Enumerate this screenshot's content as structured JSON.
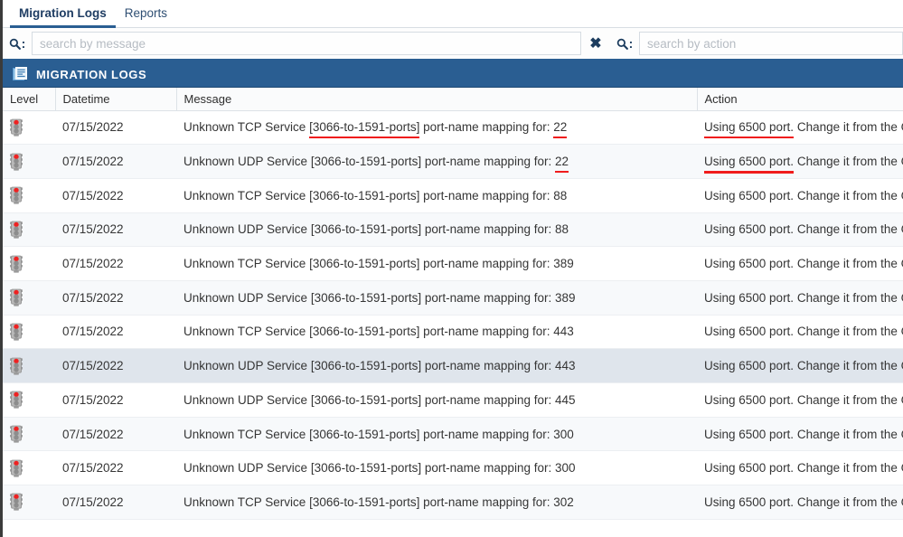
{
  "tabs": [
    {
      "label": "Migration Logs",
      "active": true
    },
    {
      "label": "Reports",
      "active": false
    }
  ],
  "search": {
    "message": {
      "placeholder": "search by message",
      "value": "",
      "icon": "search-icon",
      "colon": ":"
    },
    "action": {
      "placeholder": "search by action",
      "value": "",
      "icon": "search-icon",
      "colon": ":"
    },
    "clear_icon": "✖"
  },
  "panel": {
    "title": "MIGRATION LOGS",
    "icon": "document-report-icon",
    "header_color": "#2a5e92"
  },
  "table": {
    "columns": [
      "Level",
      "Datetime",
      "Message",
      "Action"
    ],
    "rows": [
      {
        "level_icon": "traffic-light-red-icon",
        "datetime": "07/15/2022",
        "message_pre": "Unknown TCP Service ",
        "message_mark": "[3066-to-1591-ports]",
        "message_mid": " port-name mapping for: ",
        "message_port": "22",
        "mark_underlined": true,
        "port_underlined": true,
        "action_mark": "Using 6500 port.",
        "action_rest": " Change it from the GUI",
        "action_underlined": true,
        "selected": false
      },
      {
        "level_icon": "traffic-light-red-icon",
        "datetime": "07/15/2022",
        "message_pre": "Unknown UDP Service ",
        "message_mark": "[3066-to-1591-ports]",
        "message_mid": " port-name mapping for: ",
        "message_port": "22",
        "mark_underlined": false,
        "port_underlined": true,
        "action_mark": "Using 6500 port.",
        "action_rest": " Change it from the GUI",
        "action_underlined": true,
        "selected": false
      },
      {
        "level_icon": "traffic-light-red-icon",
        "datetime": "07/15/2022",
        "message_pre": "Unknown TCP Service ",
        "message_mark": "[3066-to-1591-ports]",
        "message_mid": " port-name mapping for: ",
        "message_port": "88",
        "mark_underlined": false,
        "port_underlined": false,
        "action_mark": "Using 6500 port.",
        "action_rest": " Change it from the GUI",
        "action_underlined": false,
        "selected": false
      },
      {
        "level_icon": "traffic-light-red-icon",
        "datetime": "07/15/2022",
        "message_pre": "Unknown UDP Service ",
        "message_mark": "[3066-to-1591-ports]",
        "message_mid": " port-name mapping for: ",
        "message_port": "88",
        "mark_underlined": false,
        "port_underlined": false,
        "action_mark": "Using 6500 port.",
        "action_rest": " Change it from the GUI",
        "action_underlined": false,
        "selected": false
      },
      {
        "level_icon": "traffic-light-red-icon",
        "datetime": "07/15/2022",
        "message_pre": "Unknown TCP Service ",
        "message_mark": "[3066-to-1591-ports]",
        "message_mid": " port-name mapping for: ",
        "message_port": "389",
        "mark_underlined": false,
        "port_underlined": false,
        "action_mark": "Using 6500 port.",
        "action_rest": " Change it from the GUI",
        "action_underlined": false,
        "selected": false
      },
      {
        "level_icon": "traffic-light-red-icon",
        "datetime": "07/15/2022",
        "message_pre": "Unknown UDP Service ",
        "message_mark": "[3066-to-1591-ports]",
        "message_mid": " port-name mapping for: ",
        "message_port": "389",
        "mark_underlined": false,
        "port_underlined": false,
        "action_mark": "Using 6500 port.",
        "action_rest": " Change it from the GUI",
        "action_underlined": false,
        "selected": false
      },
      {
        "level_icon": "traffic-light-red-icon",
        "datetime": "07/15/2022",
        "message_pre": "Unknown TCP Service ",
        "message_mark": "[3066-to-1591-ports]",
        "message_mid": " port-name mapping for: ",
        "message_port": "443",
        "mark_underlined": false,
        "port_underlined": false,
        "action_mark": "Using 6500 port.",
        "action_rest": " Change it from the GUI",
        "action_underlined": false,
        "selected": false
      },
      {
        "level_icon": "traffic-light-red-icon",
        "datetime": "07/15/2022",
        "message_pre": "Unknown UDP Service ",
        "message_mark": "[3066-to-1591-ports]",
        "message_mid": " port-name mapping for: ",
        "message_port": "443",
        "mark_underlined": false,
        "port_underlined": false,
        "action_mark": "Using 6500 port.",
        "action_rest": " Change it from the GUI",
        "action_underlined": false,
        "selected": true
      },
      {
        "level_icon": "traffic-light-red-icon",
        "datetime": "07/15/2022",
        "message_pre": "Unknown UDP Service ",
        "message_mark": "[3066-to-1591-ports]",
        "message_mid": " port-name mapping for: ",
        "message_port": "445",
        "mark_underlined": false,
        "port_underlined": false,
        "action_mark": "Using 6500 port.",
        "action_rest": " Change it from the GUI",
        "action_underlined": false,
        "selected": false
      },
      {
        "level_icon": "traffic-light-red-icon",
        "datetime": "07/15/2022",
        "message_pre": "Unknown TCP Service ",
        "message_mark": "[3066-to-1591-ports]",
        "message_mid": " port-name mapping for: ",
        "message_port": "300",
        "mark_underlined": false,
        "port_underlined": false,
        "action_mark": "Using 6500 port.",
        "action_rest": " Change it from the GUI",
        "action_underlined": false,
        "selected": false
      },
      {
        "level_icon": "traffic-light-red-icon",
        "datetime": "07/15/2022",
        "message_pre": "Unknown UDP Service ",
        "message_mark": "[3066-to-1591-ports]",
        "message_mid": " port-name mapping for: ",
        "message_port": "300",
        "mark_underlined": false,
        "port_underlined": false,
        "action_mark": "Using 6500 port.",
        "action_rest": " Change it from the GUI",
        "action_underlined": false,
        "selected": false
      },
      {
        "level_icon": "traffic-light-red-icon",
        "datetime": "07/15/2022",
        "message_pre": "Unknown TCP Service ",
        "message_mark": "[3066-to-1591-ports]",
        "message_mid": " port-name mapping for: ",
        "message_port": "302",
        "mark_underlined": false,
        "port_underlined": false,
        "action_mark": "Using 6500 port.",
        "action_rest": " Change it from the GUI",
        "action_underlined": false,
        "selected": false
      }
    ]
  },
  "colors": {
    "accent_blue": "#2a5e92",
    "annotation_red": "#f01c1c",
    "row_selected": "#dfe5ec",
    "row_stripe": "#f7f9fb"
  }
}
